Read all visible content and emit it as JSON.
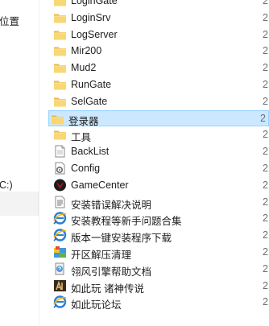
{
  "nav": {
    "items": [
      {
        "label": "位置"
      },
      {
        "label": "C:)"
      }
    ]
  },
  "files": [
    {
      "name": "LoginGate",
      "icon": "folder-icon",
      "date": "2"
    },
    {
      "name": "LoginSrv",
      "icon": "folder-icon",
      "date": "2"
    },
    {
      "name": "LogServer",
      "icon": "folder-icon",
      "date": "2"
    },
    {
      "name": "Mir200",
      "icon": "folder-icon",
      "date": "2"
    },
    {
      "name": "Mud2",
      "icon": "folder-icon",
      "date": "2"
    },
    {
      "name": "RunGate",
      "icon": "folder-icon",
      "date": "2"
    },
    {
      "name": "SelGate",
      "icon": "folder-icon",
      "date": "2"
    },
    {
      "name": "登录器",
      "icon": "folder-icon",
      "date": "2",
      "selected": true
    },
    {
      "name": "工具",
      "icon": "folder-icon",
      "date": "2"
    },
    {
      "name": "BackList",
      "icon": "text-file-icon",
      "date": "2"
    },
    {
      "name": "Config",
      "icon": "config-file-icon",
      "date": "2"
    },
    {
      "name": "GameCenter",
      "icon": "game-center-icon",
      "date": "2"
    },
    {
      "name": "安装错误解决说明",
      "icon": "document-icon",
      "date": "2"
    },
    {
      "name": "安装教程等新手问题合集",
      "icon": "ie-shortcut-icon",
      "date": "2"
    },
    {
      "name": "版本一键安装程序下载",
      "icon": "ie-shortcut-icon",
      "date": "2"
    },
    {
      "name": "开区解压清理",
      "icon": "installer-icon",
      "date": "2"
    },
    {
      "name": "翎风引擎帮助文档",
      "icon": "help-file-icon",
      "date": "2"
    },
    {
      "name": "如此玩 诸神传说",
      "icon": "game-shortcut-icon",
      "date": "2"
    },
    {
      "name": "如此玩论坛",
      "icon": "ie-shortcut-icon",
      "date": "2"
    }
  ],
  "colors": {
    "selection_bg": "#cce8ff",
    "selection_border": "#99d1ff",
    "folder": "#f8d775"
  }
}
